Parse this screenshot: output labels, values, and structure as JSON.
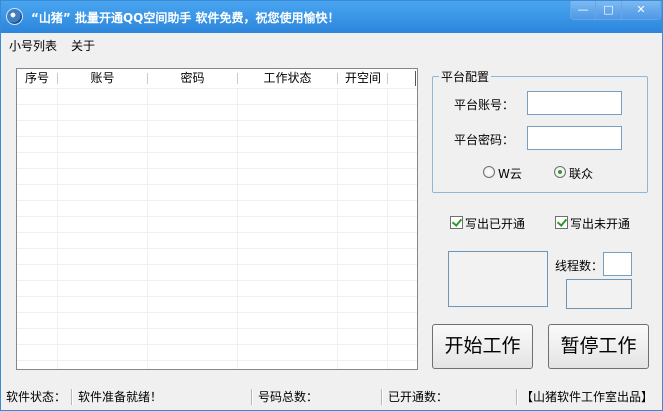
{
  "window": {
    "title": "“山猪” 批量开通QQ空间助手  软件免费，祝您使用愉快！",
    "controls": {
      "minimize": "—",
      "maximize": "□",
      "close": "✕"
    }
  },
  "menu": {
    "items": [
      "小号列表",
      "关于"
    ]
  },
  "table": {
    "columns": [
      "序号",
      "账号",
      "密码",
      "工作状态",
      "开空间"
    ],
    "rows": []
  },
  "platform": {
    "group_title": "平台配置",
    "account_label": "平台账号：",
    "account_value": "",
    "password_label": "平台密码：",
    "password_value": "",
    "radio_options": [
      "W云",
      "联众"
    ],
    "radio_selected": "联众"
  },
  "options": {
    "write_opened_label": "写出已开通",
    "write_opened_checked": true,
    "write_unopened_label": "写出未开通",
    "write_unopened_checked": true,
    "threads_label": "线程数：",
    "threads_value": ""
  },
  "buttons": {
    "start": "开始工作",
    "pause": "暂停工作"
  },
  "status": {
    "state_label": "软件状态：",
    "state_value": "软件准备就绪！",
    "total_label": "号码总数：",
    "total_value": "",
    "opened_label": "已开通数：",
    "opened_value": "",
    "credit": "【山猪软件工作室出品】"
  },
  "colors": {
    "titlebar": "#2b86dc",
    "accent_check": "#2a9a2a"
  }
}
